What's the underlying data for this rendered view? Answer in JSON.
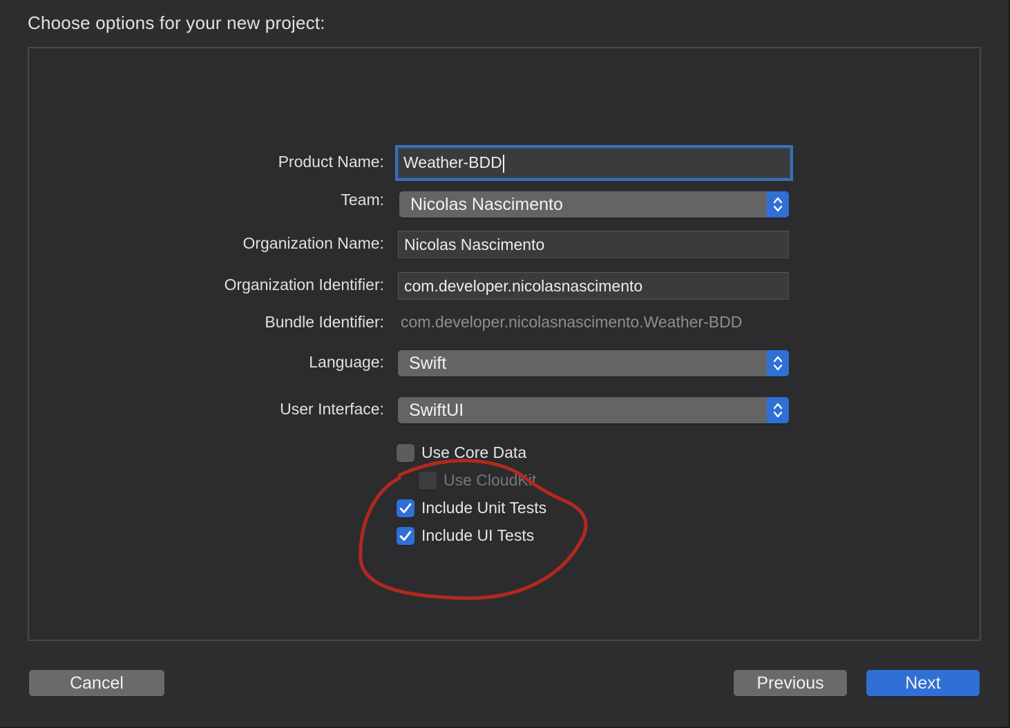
{
  "header": {
    "title": "Choose options for your new project:"
  },
  "form": {
    "product_name": {
      "label": "Product Name:",
      "value": "Weather-BDD"
    },
    "team": {
      "label": "Team:",
      "value": "Nicolas Nascimento"
    },
    "organization_name": {
      "label": "Organization Name:",
      "value": "Nicolas Nascimento"
    },
    "organization_identifier": {
      "label": "Organization Identifier:",
      "value": "com.developer.nicolasnascimento"
    },
    "bundle_identifier": {
      "label": "Bundle Identifier:",
      "value": "com.developer.nicolasnascimento.Weather-BDD"
    },
    "language": {
      "label": "Language:",
      "value": "Swift"
    },
    "user_interface": {
      "label": "User Interface:",
      "value": "SwiftUI"
    }
  },
  "options": [
    {
      "label": "Use Core Data",
      "checked": false,
      "enabled": true
    },
    {
      "label": "Use CloudKit",
      "checked": false,
      "enabled": false
    },
    {
      "label": "Include Unit Tests",
      "checked": true,
      "enabled": true
    },
    {
      "label": "Include UI Tests",
      "checked": true,
      "enabled": true
    }
  ],
  "footer": {
    "cancel_label": "Cancel",
    "previous_label": "Previous",
    "next_label": "Next"
  },
  "colors": {
    "accent": "#2f6fd6",
    "annotation": "#b3281f",
    "background": "#2d2d2f"
  },
  "icons": {
    "popup_stepper": "chevron-up-down-icon",
    "checkmark": "checkmark-icon"
  }
}
